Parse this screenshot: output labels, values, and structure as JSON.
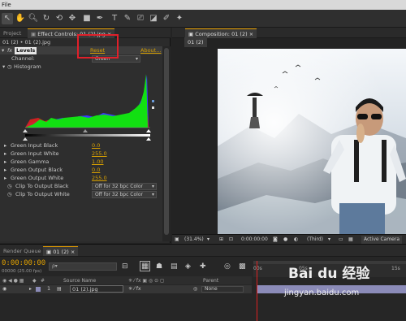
{
  "menu": {
    "first_item": "File"
  },
  "effect_controls": {
    "project_tab": "Project",
    "panel_tab": "Effect Controls: 01 (2).jpg",
    "breadcrumb": "01 (2) • 01 (2).jpg",
    "effect_name": "Levels",
    "reset_label": "Reset",
    "about_label": "About...",
    "channel_label": "Channel:",
    "channel_value": "Green",
    "histogram_label": "Histogram",
    "properties": [
      {
        "label": "Green Input Black",
        "value": "0.0"
      },
      {
        "label": "Green Input White",
        "value": "255.0"
      },
      {
        "label": "Green Gamma",
        "value": "1.00"
      },
      {
        "label": "Green Output Black",
        "value": "0.0"
      },
      {
        "label": "Green Output White",
        "value": "255.0"
      }
    ],
    "clip_black_label": "Clip To Output Black",
    "clip_black_value": "Off for 32 bpc Color",
    "clip_white_label": "Clip To Output White",
    "clip_white_value": "Off for 32 bpc Color"
  },
  "composition": {
    "panel_tab": "Composition: 01 (2)",
    "comp_tab": "01 (2)",
    "zoom": "(31.4%)",
    "timecode": "0:00:00:00",
    "resolution": "(Third)",
    "camera": "Active Camera"
  },
  "timeline": {
    "render_queue_tab": "Render Queue",
    "comp_tab": "01 (2)",
    "current_time": "0:00:00:00",
    "fps_label": "00000 (25.00 fps)",
    "search_placeholder": "ρ▾",
    "col_source_name": "Source Name",
    "col_parent": "Parent",
    "layer_number": "1",
    "layer_name": "01 (2).jpg",
    "layer_parent": "None",
    "ruler_ticks": [
      "00s",
      "05s",
      "10s",
      "15s"
    ]
  },
  "watermark": {
    "logo": "Bai du 经验",
    "url": "jingyan.baidu.com"
  }
}
